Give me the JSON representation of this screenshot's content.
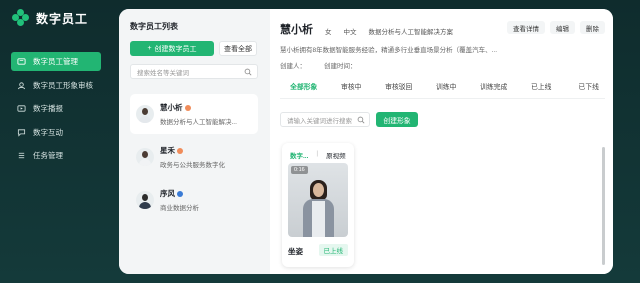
{
  "app": {
    "title": "数字员工"
  },
  "sidebar": {
    "items": [
      {
        "label": "数字员工管理",
        "icon": "users-icon",
        "active": true
      },
      {
        "label": "数字员工形象审核",
        "icon": "image-review-icon",
        "active": false
      },
      {
        "label": "数字播报",
        "icon": "broadcast-icon",
        "active": false
      },
      {
        "label": "数字互动",
        "icon": "chat-icon",
        "active": false
      },
      {
        "label": "任务管理",
        "icon": "task-icon",
        "active": false
      }
    ]
  },
  "list_panel": {
    "title": "数字员工列表",
    "create_button": "创建数字员工",
    "view_all_button": "查看全部",
    "search_placeholder": "搜索姓名等关键词",
    "employees": [
      {
        "name": "慧小析",
        "desc": "数据分析与人工智能解决...",
        "badge_color": "#f08c5a",
        "selected": true
      },
      {
        "name": "星禾",
        "desc": "政务与公共服务数字化",
        "badge_color": "#f08c5a",
        "selected": false
      },
      {
        "name": "序风",
        "desc": "商业数据分析",
        "badge_color": "#3a7bd5",
        "selected": false
      }
    ]
  },
  "detail": {
    "name": "慧小析",
    "gender": "女",
    "language": "中文",
    "domain": "数据分析与人工智能解决方案",
    "actions": {
      "view": "查看详情",
      "edit": "编辑",
      "delete": "删除"
    },
    "description": "慧小析拥有8年数据智能服务经验，精通多行业垂直场景分析（覆盖汽车、...",
    "creator_label": "创建人：",
    "created_time_label": "创建时间：",
    "tabs": [
      "全部形象",
      "审核中",
      "审核驳回",
      "训练中",
      "训练完成",
      "已上线",
      "已下线"
    ],
    "active_tab": 0,
    "keyword_placeholder": "请输入关键词进行搜索",
    "create_image_button": "创建形象",
    "card": {
      "tabs": [
        "数字...",
        "原视频"
      ],
      "duration": "0:16",
      "title": "坐姿",
      "status": "已上线"
    }
  },
  "colors": {
    "accent": "#22b573",
    "sidebar_bg": "#0f2c2d"
  }
}
